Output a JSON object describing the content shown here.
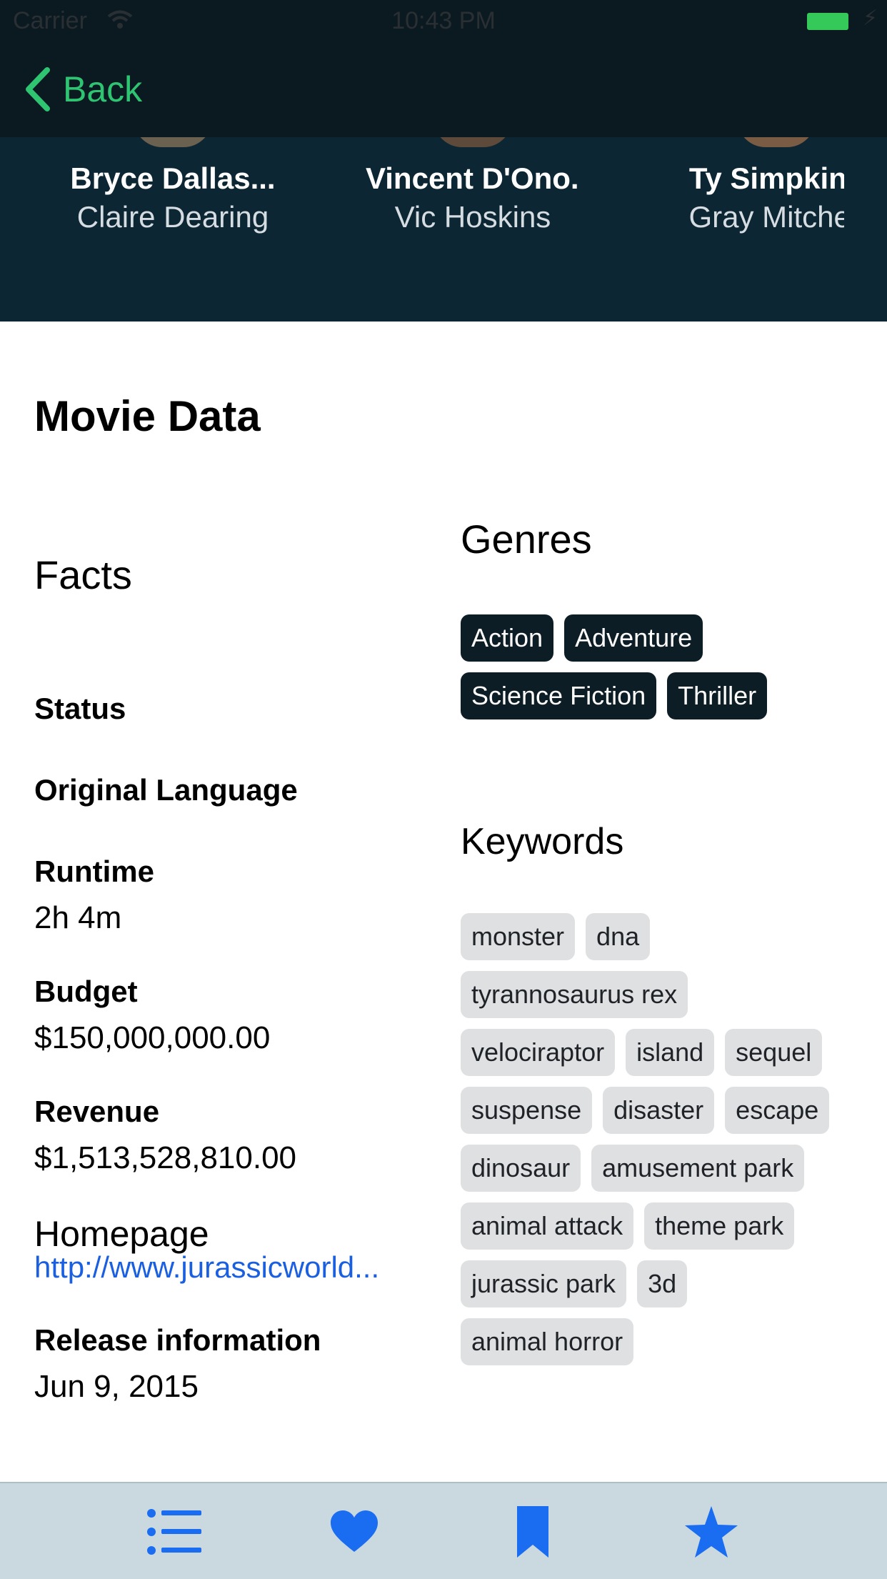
{
  "status_bar": {
    "carrier": "Carrier",
    "time": "10:43 PM"
  },
  "nav": {
    "back_label": "Back"
  },
  "cast": [
    {
      "name": "Bryce Dallas...",
      "role": "Claire Dearing"
    },
    {
      "name": "Vincent D'Ono...",
      "role": "Vic Hoskins"
    },
    {
      "name": "Ty Simpkins",
      "role": "Gray Mitchell"
    }
  ],
  "movie_data": {
    "title": "Movie Data",
    "facts_title": "Facts",
    "status_label": "Status",
    "original_language_label": "Original Language",
    "runtime_label": "Runtime",
    "runtime_value": "2h 4m",
    "budget_label": "Budget",
    "budget_value": "$150,000,000.00",
    "revenue_label": "Revenue",
    "revenue_value": "$1,513,528,810.00",
    "homepage_label": "Homepage",
    "homepage_value": "http://www.jurassicworld...",
    "release_label": "Release information",
    "release_value": "Jun 9, 2015"
  },
  "genres": {
    "title": "Genres",
    "items": [
      "Action",
      "Adventure",
      "Science Fiction",
      "Thriller"
    ]
  },
  "keywords": {
    "title": "Keywords",
    "items": [
      "monster",
      "dna",
      "tyrannosaurus rex",
      "velociraptor",
      "island",
      "sequel",
      "suspense",
      "disaster",
      "escape",
      "dinosaur",
      "amusement park",
      "animal attack",
      "theme park",
      "jurassic park",
      "3d",
      "animal horror"
    ]
  },
  "tab_bar": {
    "items": [
      {
        "icon": "list-icon"
      },
      {
        "icon": "heart-icon"
      },
      {
        "icon": "bookmark-icon"
      },
      {
        "icon": "star-icon"
      }
    ],
    "accent": "#1a6cf0"
  }
}
